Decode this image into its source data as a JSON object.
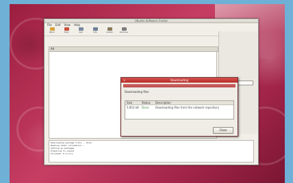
{
  "window": {
    "title": "Ubuntu Software Center",
    "menu": [
      "File",
      "Edit",
      "View",
      "Help"
    ],
    "toolbar": [
      {
        "label": "Back",
        "icon": "back-arrow-icon",
        "color": "#d9a23a"
      },
      {
        "label": "Stop",
        "icon": "stop-icon",
        "color": "#c94f3a"
      },
      {
        "label": "Get",
        "icon": "download-icon",
        "color": "#7a8aa0"
      },
      {
        "label": "Info",
        "icon": "info-icon",
        "color": "#6d7f96"
      },
      {
        "label": "Install",
        "icon": "package-icon",
        "color": "#8a7a5a"
      },
      {
        "label": "Remove",
        "icon": "trash-icon",
        "color": "#7d7d7d"
      }
    ],
    "tab_label": "All",
    "sidebar_field": "Search",
    "log_lines": [
      "Downloading package lists... Done",
      "Reading state information...",
      "Setting up packages",
      "  Preparing to unpack",
      "  Finished: 0 errors"
    ]
  },
  "dialog": {
    "title": "Downloading",
    "header": "Downloading files",
    "columns": [
      "Size",
      "Status",
      "Description"
    ],
    "rows": [
      {
        "size": "5,853 kB",
        "status": "Done",
        "desc": "Downloading files from the network repository"
      }
    ],
    "button": "Close"
  },
  "colors": {
    "accent": "#c0392b",
    "wallpaper": "#a3254a"
  }
}
